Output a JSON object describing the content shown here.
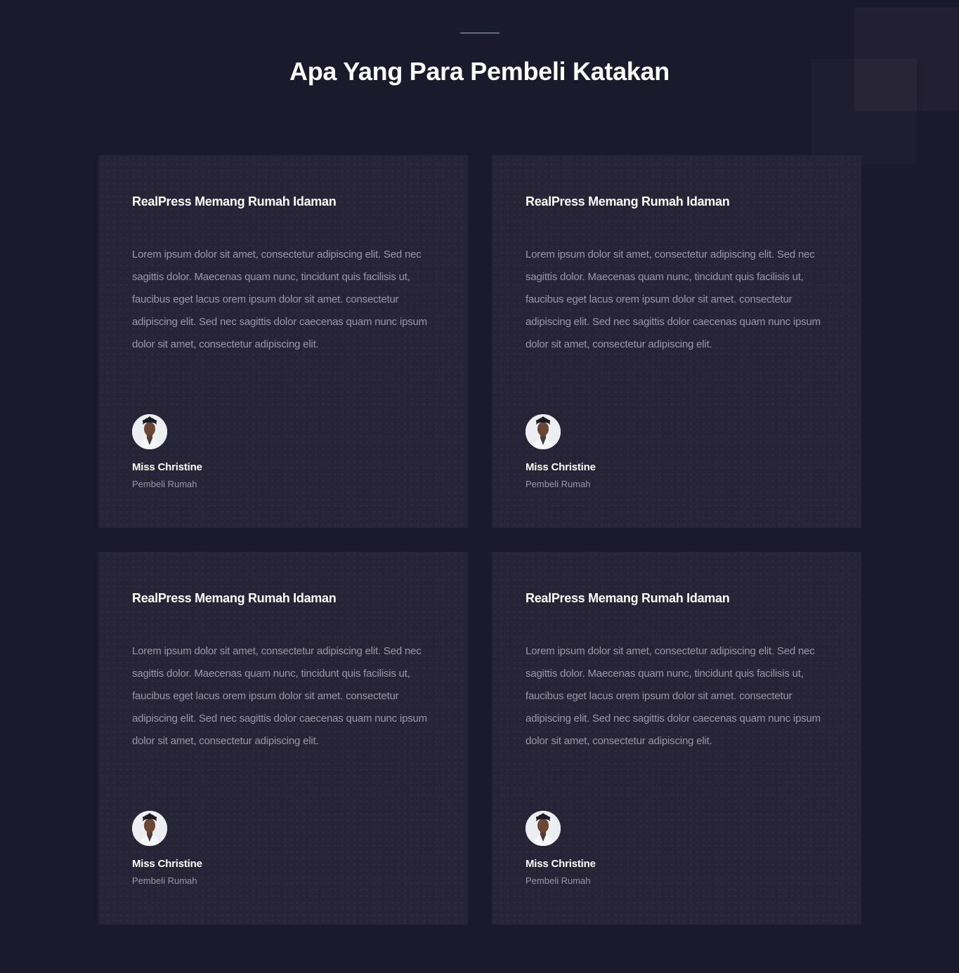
{
  "section": {
    "title": "Apa Yang Para Pembeli Katakan"
  },
  "testimonials": [
    {
      "heading": "RealPress Memang Rumah Idaman",
      "body": "Lorem ipsum dolor sit amet, consectetur adipiscing elit. Sed nec sagittis dolor. Maecenas quam nunc, tincidunt quis facilisis ut, faucibus eget lacus orem ipsum dolor sit amet. consectetur adipiscing elit. Sed nec sagittis dolor caecenas quam nunc ipsum dolor sit amet, consectetur adipiscing elit.",
      "author": "Miss Christine",
      "role": "Pembeli Rumah",
      "avatar_icon": "person-photo"
    },
    {
      "heading": "RealPress Memang Rumah Idaman",
      "body": "Lorem ipsum dolor sit amet, consectetur adipiscing elit. Sed nec sagittis dolor. Maecenas quam nunc, tincidunt quis facilisis ut, faucibus eget lacus orem ipsum dolor sit amet. consectetur adipiscing elit. Sed nec sagittis dolor caecenas quam nunc ipsum dolor sit amet, consectetur adipiscing elit.",
      "author": "Miss Christine",
      "role": "Pembeli Rumah",
      "avatar_icon": "person-photo"
    },
    {
      "heading": "RealPress Memang Rumah Idaman",
      "body": "Lorem ipsum dolor sit amet, consectetur adipiscing elit. Sed nec sagittis dolor. Maecenas quam nunc, tincidunt quis facilisis ut, faucibus eget lacus orem ipsum dolor sit amet. consectetur adipiscing elit. Sed nec sagittis dolor caecenas quam nunc ipsum dolor sit amet, consectetur adipiscing elit.",
      "author": "Miss Christine",
      "role": "Pembeli Rumah",
      "avatar_icon": "person-photo"
    },
    {
      "heading": "RealPress Memang Rumah Idaman",
      "body": "Lorem ipsum dolor sit amet, consectetur adipiscing elit. Sed nec sagittis dolor. Maecenas quam nunc, tincidunt quis facilisis ut, faucibus eget lacus orem ipsum dolor sit amet. consectetur adipiscing elit. Sed nec sagittis dolor caecenas quam nunc ipsum dolor sit amet, consectetur adipiscing elit.",
      "author": "Miss Christine",
      "role": "Pembeli Rumah",
      "avatar_icon": "person-photo"
    }
  ],
  "colors": {
    "page_background": "#1b192c",
    "card_background": "#262436",
    "heading_text": "#ffffff",
    "body_text": "#9b98a6",
    "divider": "#5f6b86"
  }
}
